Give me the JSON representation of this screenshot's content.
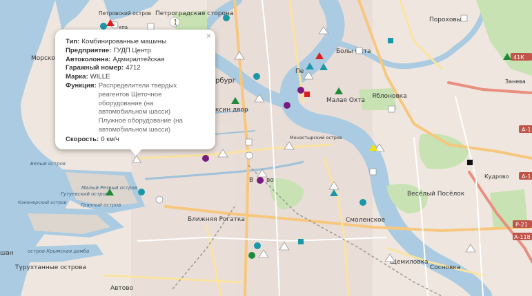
{
  "map": {
    "places": [
      {
        "key": "petrogradsky",
        "text": "Петроградская сторона"
      },
      {
        "key": "petrovsky",
        "text": "Петровский остров"
      },
      {
        "key": "porokhovye",
        "text": "Пороховые"
      },
      {
        "key": "bolshaya_okhta",
        "text": "Болы   Охта"
      },
      {
        "key": "malaya_okhta",
        "text": "Малая Охта"
      },
      {
        "key": "yablonovka",
        "text": "Яблоновка"
      },
      {
        "key": "zanevka",
        "text": "Занева"
      },
      {
        "key": "morskoy",
        "text": "Морской"
      },
      {
        "key": "peterburg",
        "text": "рбург"
      },
      {
        "key": "gostiny",
        "text": "ксин двор"
      },
      {
        "key": "monastyrsky",
        "text": "Монастырский остров"
      },
      {
        "key": "kudrovo",
        "text": "Кудрово"
      },
      {
        "key": "belyi",
        "text": "Белый остров"
      },
      {
        "key": "malyi_rezvyi",
        "text": "Малый Резвый остров"
      },
      {
        "key": "gutuevsky",
        "text": "Гутуевский остров"
      },
      {
        "key": "kanonersky",
        "text": "Канонерский остров"
      },
      {
        "key": "gryaznyi",
        "text": "Грязный остров"
      },
      {
        "key": "vesyolyi",
        "text": "Весёлый Посёлок"
      },
      {
        "key": "blizhnyaya",
        "text": "Ближняя Рогатка"
      },
      {
        "key": "smolenskoe",
        "text": "Смоленское"
      },
      {
        "key": "krimski",
        "text": "остров Крымская дамба"
      },
      {
        "key": "turukhtannye",
        "text": "Турухтанные острова"
      },
      {
        "key": "shchemilovka",
        "text": "Щемиловка"
      },
      {
        "key": "sosnovka",
        "text": "Сосновка"
      },
      {
        "key": "avtovo",
        "text": "Автово"
      },
      {
        "key": "vi",
        "text": "В"
      },
      {
        "key": "vo",
        "text": "во"
      },
      {
        "key": "pe",
        "text": "Пе"
      },
      {
        "key": "kpa",
        "text": "кпа"
      },
      {
        "key": "shan",
        "text": "шан"
      }
    ],
    "roads": [
      {
        "key": "a1a",
        "text": "А-1"
      },
      {
        "key": "a1b",
        "text": "А-1"
      },
      {
        "key": "km41",
        "text": "41К"
      },
      {
        "key": "p21",
        "text": "Р-21"
      },
      {
        "key": "a118",
        "text": "А-118"
      }
    ]
  },
  "popup": {
    "close_label": "×",
    "fields": [
      {
        "label": "Тип:",
        "value": "Комбинированные машины"
      },
      {
        "label": "Предприятие:",
        "value": "ГУДП Центр"
      },
      {
        "label": "Автоколонна:",
        "value": "Адмиралтейская"
      },
      {
        "label": "Гаражный номер:",
        "value": "4712"
      },
      {
        "label": "Марка:",
        "value": "WILLE"
      }
    ],
    "function_label": "Функция:",
    "function_value": "Распределители твердых реагентов Щеточное оборудование (на автомобильном шасси) Плужное оборудование (на автомобильном шасси)",
    "speed_label": "Скорость:",
    "speed_value": "0 км/ч"
  },
  "colors": {
    "marker_white": "#ffffff",
    "marker_teal": "#1b97a8",
    "marker_purple": "#7a1a7e",
    "marker_green": "#1e8a3a",
    "marker_red": "#e11b1b",
    "marker_black": "#111111",
    "marker_yellow": "#f2e200",
    "water": "#a9cbe0",
    "park": "#c9e3b5"
  }
}
